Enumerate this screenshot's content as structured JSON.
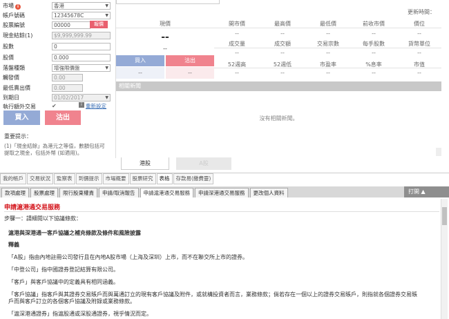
{
  "form": {
    "market_label": "市場",
    "market_value": "香港",
    "account_label": "帳戶號碼",
    "account_value": "12345678C",
    "stock_label": "股票編號",
    "stock_value": "00000",
    "fast_button": "報價",
    "cash_label": "現金結餘(1)",
    "cash_value": "$9,999,999.99",
    "qty_label": "股數",
    "qty_value": "0",
    "price_label": "股價",
    "price_value": "0.000",
    "order_type_label": "落盤種類",
    "order_type_value": "增強限價盤",
    "trigger_label": "觸發價",
    "trigger_value": "0.00",
    "max_price_label": "最低賣出價",
    "max_price_value": "0.00",
    "expiry_label": "到期日",
    "expiry_value": "01/02/2017",
    "offhours_label": "執行額外交易",
    "reset_label": "重新設定",
    "buy_label": "買入",
    "sell_label": "沽出",
    "notes_title": "重要提示：",
    "notes_text": "(1)「現金結餘」為港元之等值，數額包括可提取之現金，包括外幣 (如適用)。"
  },
  "quote": {
    "update_label": "更新時間：",
    "headers_row1": [
      "現價",
      "開市價",
      "最高價",
      "最低價",
      "前收市價",
      "價位"
    ],
    "headers_row2": [
      "成交量",
      "成交額",
      "交易宗數",
      "每手股數",
      "貨幣單位"
    ],
    "headers_row3": [
      "52週高",
      "52週低",
      "市盈率",
      "%息率",
      "市值"
    ],
    "price_value": "--",
    "price_change": "--",
    "dash": "--",
    "buy_label": "買入",
    "sell_label": "沽出",
    "news_title": "相關新聞",
    "news_empty": "沒有相關新聞。",
    "tab_hk": "港股",
    "tab_a": "A股"
  },
  "nav1": [
    "我的帳戶",
    "交易狀況",
    "監察表",
    "到價提示",
    "市場概要",
    "股票研究",
    "表格",
    "存款易(繳費靈)"
  ],
  "nav2": [
    "款項處理",
    "股票處理",
    "限行股東權責",
    "申請/取消報告",
    "申請滬港通交易服務",
    "申請深港通交易服務",
    "更改個人資料"
  ],
  "print_label": "打開 ▲",
  "doc": {
    "title": "申請滬港通交易服務",
    "step": "步驟一：請細閱以下協議條款：",
    "heading": "滬港與深港通一客戶協議之補充條款及條件和風險披露",
    "section": "釋義",
    "p1": "「A股」指由內地註冊公司發行且在內地A股市場（上海及深圳）上市，而不在聯交所上市的證券。",
    "p2": "「中登公司」指中國證券登記結算有限公司。",
    "p3": "「客戶」與客戶協議中的定義具有相同涵義。",
    "p4a": "「客戶協議」指客戶與其證券交易賬戶而與萬通訂立的現有客戶協議及附件，或就構投資者而言，業務條款；倘若存在一個以上的證券交易賬戶，則指就各個證券交易賬",
    "p4b": "戶而與客戶訂立的各個客戶協議及附錄或業務條款。",
    "p5": "「滬深港通證券」指滬股通或深股通證券，視乎情況而定。"
  }
}
